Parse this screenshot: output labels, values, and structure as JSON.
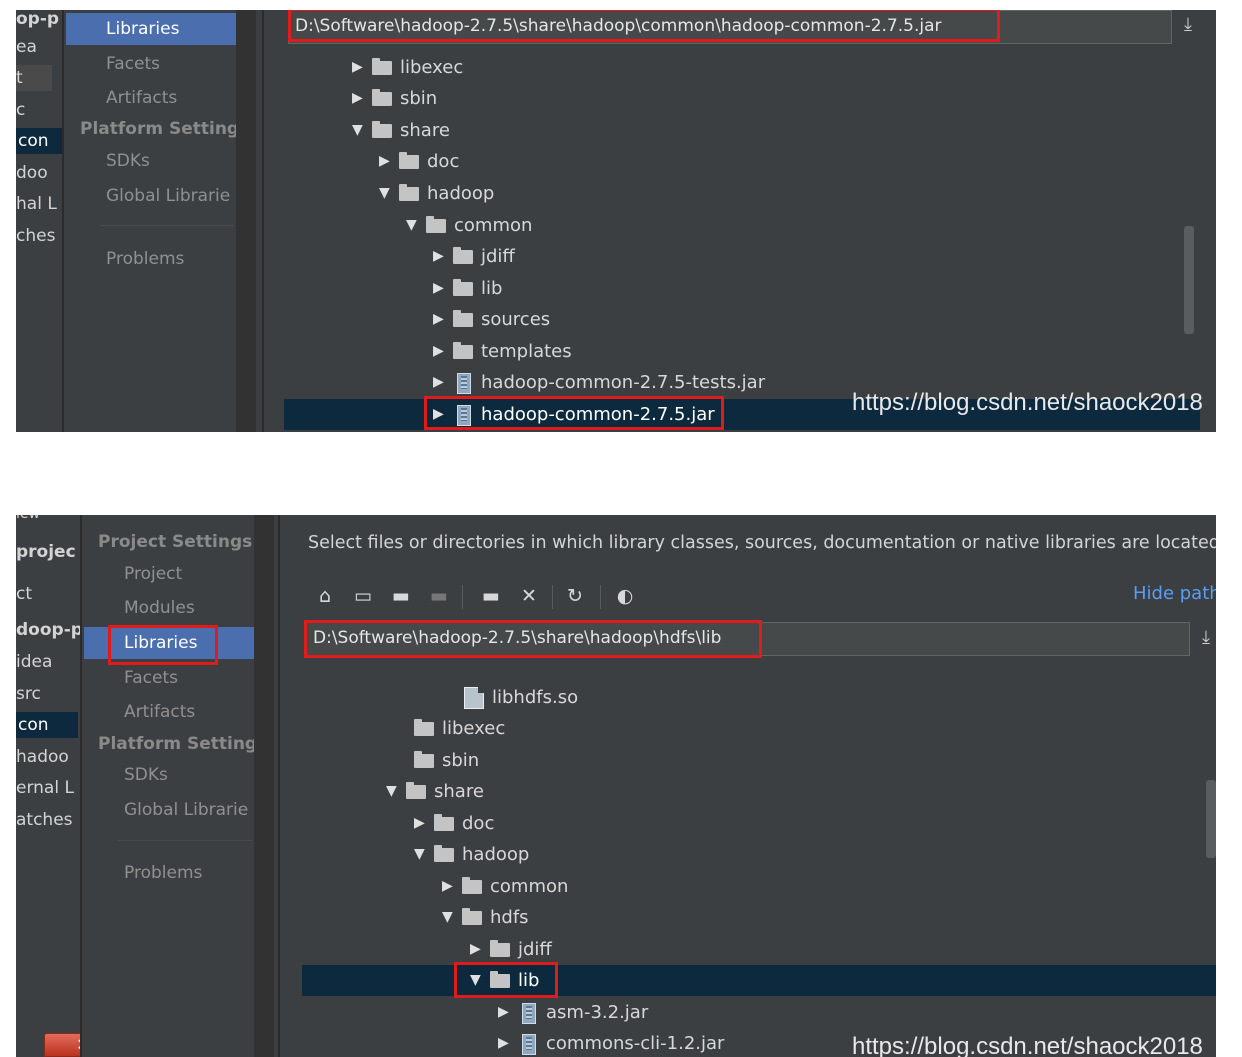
{
  "shot1": {
    "edge_items": [
      "op-p",
      "ea",
      "t",
      "c",
      "con",
      "doo",
      "hal L",
      "ches"
    ],
    "nav": {
      "libraries": "Libraries",
      "facets": "Facets",
      "artifacts": "Artifacts",
      "platform_settings": "Platform Setting:",
      "sdks": "SDKs",
      "global_libraries": "Global Librarie",
      "problems": "Problems"
    },
    "path": "D:\\Software\\hadoop-2.7.5\\share\\hadoop\\common\\hadoop-common-2.7.5.jar",
    "download_icon": "download-icon",
    "tree": [
      {
        "label": "libexec",
        "type": "folder",
        "expanded": false
      },
      {
        "label": "sbin",
        "type": "folder",
        "expanded": false
      },
      {
        "label": "share",
        "type": "folder",
        "expanded": true
      },
      {
        "label": "doc",
        "type": "folder",
        "expanded": false
      },
      {
        "label": "hadoop",
        "type": "folder",
        "expanded": true
      },
      {
        "label": "common",
        "type": "folder",
        "expanded": true
      },
      {
        "label": "jdiff",
        "type": "folder",
        "expanded": false
      },
      {
        "label": "lib",
        "type": "folder",
        "expanded": false
      },
      {
        "label": "sources",
        "type": "folder",
        "expanded": false
      },
      {
        "label": "templates",
        "type": "folder",
        "expanded": false
      },
      {
        "label": "hadoop-common-2.7.5-tests.jar",
        "type": "jar",
        "expanded": false
      },
      {
        "label": "hadoop-common-2.7.5.jar",
        "type": "jar",
        "expanded": false,
        "selected": true
      }
    ],
    "watermark": "https://blog.csdn.net/shaock2018"
  },
  "shot2": {
    "edge_items": [
      "iew",
      "projec",
      "ct",
      "doop-p",
      "idea",
      "src",
      "con",
      "hadoo",
      "ernal L",
      "atches"
    ],
    "nav": {
      "project_settings": "Project Settings",
      "project": "Project",
      "modules": "Modules",
      "libraries": "Libraries",
      "facets": "Facets",
      "artifacts": "Artifacts",
      "platform_settings": "Platform Setting:",
      "sdks": "SDKs",
      "global_libraries": "Global Librarie",
      "problems": "Problems"
    },
    "description": "Select files or directories in which library classes, sources, documentation or native libraries are located",
    "toolbar": {
      "icons": [
        "home-icon",
        "desktop-icon",
        "new-folder-icon",
        "folder-icon",
        "new-folder-plus-icon",
        "delete-icon",
        "refresh-icon",
        "show-hidden-icon"
      ]
    },
    "hide_path": "Hide path",
    "path": "D:\\Software\\hadoop-2.7.5\\share\\hadoop\\hdfs\\lib",
    "download_icon": "download-icon",
    "tree": [
      {
        "label": "libhdfs.so",
        "type": "file",
        "expanded": false
      },
      {
        "label": "libexec",
        "type": "folder",
        "expanded": false
      },
      {
        "label": "sbin",
        "type": "folder",
        "expanded": false
      },
      {
        "label": "share",
        "type": "folder",
        "expanded": true
      },
      {
        "label": "doc",
        "type": "folder",
        "expanded": false
      },
      {
        "label": "hadoop",
        "type": "folder",
        "expanded": true
      },
      {
        "label": "common",
        "type": "folder",
        "expanded": false
      },
      {
        "label": "hdfs",
        "type": "folder",
        "expanded": true
      },
      {
        "label": "jdiff",
        "type": "folder",
        "expanded": false
      },
      {
        "label": "lib",
        "type": "folder",
        "expanded": true,
        "selected": true
      },
      {
        "label": "asm-3.2.jar",
        "type": "jar",
        "expanded": false
      },
      {
        "label": "commons-cli-1.2.jar",
        "type": "jar",
        "expanded": false
      }
    ],
    "close_label": "✕",
    "watermark": "https://blog.csdn.net/shaock2018"
  },
  "colors": {
    "background": "#3c3f41",
    "selection": "#0d293e",
    "nav_selected": "#4b6eaf",
    "highlight_box": "#e01b1b",
    "link": "#589df6"
  }
}
